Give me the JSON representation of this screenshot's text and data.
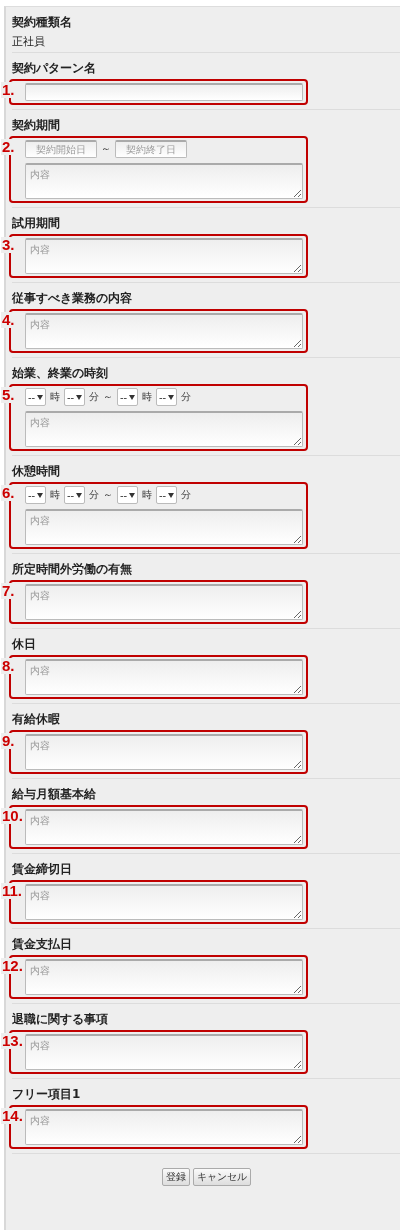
{
  "contract_type": {
    "label": "契約種類名",
    "value": "正社員"
  },
  "sections": [
    {
      "kind": "text",
      "label": "契約パターン名",
      "marker": "1."
    },
    {
      "kind": "date_range",
      "label": "契約期間",
      "marker": "2.",
      "start_placeholder": "契約開始日",
      "separator": "～",
      "end_placeholder": "契約終了日",
      "placeholder": "内容"
    },
    {
      "kind": "textarea",
      "label": "試用期間",
      "marker": "3.",
      "placeholder": "内容"
    },
    {
      "kind": "textarea",
      "label": "従事すべき業務の内容",
      "marker": "4.",
      "placeholder": "内容"
    },
    {
      "kind": "time_range",
      "label": "始業、終業の時刻",
      "marker": "5.",
      "parts": [
        {
          "kind": "select",
          "text": "--"
        },
        {
          "kind": "unit",
          "text": "時"
        },
        {
          "kind": "select",
          "text": "--"
        },
        {
          "kind": "unit",
          "text": "分"
        },
        {
          "kind": "unit",
          "text": "～"
        },
        {
          "kind": "select",
          "text": "--"
        },
        {
          "kind": "unit",
          "text": "時"
        },
        {
          "kind": "select",
          "text": "--"
        },
        {
          "kind": "unit",
          "text": "分"
        }
      ],
      "placeholder": "内容"
    },
    {
      "kind": "time_range",
      "label": "休憩時間",
      "marker": "6.",
      "parts": [
        {
          "kind": "select",
          "text": "--"
        },
        {
          "kind": "unit",
          "text": "時"
        },
        {
          "kind": "select",
          "text": "--"
        },
        {
          "kind": "unit",
          "text": "分"
        },
        {
          "kind": "unit",
          "text": "～"
        },
        {
          "kind": "select",
          "text": "--"
        },
        {
          "kind": "unit",
          "text": "時"
        },
        {
          "kind": "select",
          "text": "--"
        },
        {
          "kind": "unit",
          "text": "分"
        }
      ],
      "placeholder": "内容"
    },
    {
      "kind": "textarea",
      "label": "所定時間外労働の有無",
      "marker": "7.",
      "placeholder": "内容"
    },
    {
      "kind": "textarea",
      "label": "休日",
      "marker": "8.",
      "placeholder": "内容"
    },
    {
      "kind": "textarea",
      "label": "有給休暇",
      "marker": "9.",
      "placeholder": "内容"
    },
    {
      "kind": "textarea",
      "label": "給与月額基本給",
      "marker": "10.",
      "placeholder": "内容"
    },
    {
      "kind": "textarea",
      "label": "賃金締切日",
      "marker": "11.",
      "placeholder": "内容"
    },
    {
      "kind": "textarea",
      "label": "賃金支払日",
      "marker": "12.",
      "placeholder": "内容"
    },
    {
      "kind": "textarea",
      "label": "退職に関する事項",
      "marker": "13.",
      "placeholder": "内容"
    },
    {
      "kind": "textarea",
      "label": "フリー項目1",
      "marker": "14.",
      "placeholder": "内容"
    }
  ],
  "buttons": [
    "登録",
    "キャンセル"
  ]
}
